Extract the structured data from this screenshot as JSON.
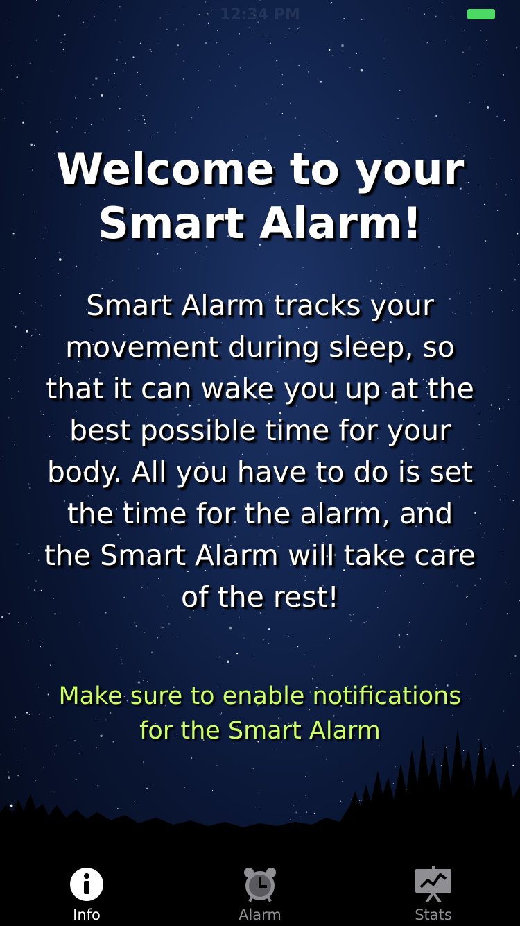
{
  "status_bar": {
    "time": "12:34 PM",
    "battery_color": "#4cd964"
  },
  "info": {
    "title": "Welcome to your Smart Alarm!",
    "body": "Smart Alarm tracks your movement during sleep, so that it can wake you up at the best possible time for your body. All you have to do is set the time for the alarm, and the Smart Alarm will take care of the rest!",
    "note": "Make sure to enable notifications for the Smart Alarm",
    "note_color": "#ccff66"
  },
  "tab_bar": {
    "tabs": [
      {
        "label": "Info",
        "icon": "info-icon",
        "active": true
      },
      {
        "label": "Alarm",
        "icon": "alarm-clock-icon",
        "active": false
      },
      {
        "label": "Stats",
        "icon": "stats-chart-icon",
        "active": false
      }
    ]
  }
}
